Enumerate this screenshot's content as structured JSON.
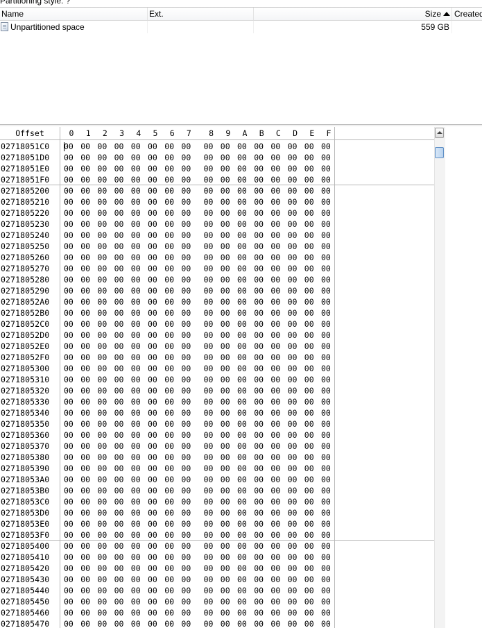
{
  "partitioning_label": "Partitioning style: ?",
  "list": {
    "columns": {
      "name": "Name",
      "ext": "Ext.",
      "size": "Size",
      "created": "Created"
    },
    "rows": [
      {
        "name": "Unpartitioned space",
        "ext": "",
        "size": "559 GB",
        "icon": "file-icon"
      }
    ]
  },
  "hex": {
    "offset_title": "Offset",
    "columns": [
      "0",
      "1",
      "2",
      "3",
      "4",
      "5",
      "6",
      "7",
      "8",
      "9",
      "A",
      "B",
      "C",
      "D",
      "E",
      "F"
    ],
    "cursor_at": "first byte of first row",
    "rows": [
      {
        "offset": "02718051C0",
        "bytes": [
          "00",
          "00",
          "00",
          "00",
          "00",
          "00",
          "00",
          "00",
          "00",
          "00",
          "00",
          "00",
          "00",
          "00",
          "00",
          "00"
        ]
      },
      {
        "offset": "02718051D0",
        "bytes": [
          "00",
          "00",
          "00",
          "00",
          "00",
          "00",
          "00",
          "00",
          "00",
          "00",
          "00",
          "00",
          "00",
          "00",
          "00",
          "00"
        ]
      },
      {
        "offset": "02718051E0",
        "bytes": [
          "00",
          "00",
          "00",
          "00",
          "00",
          "00",
          "00",
          "00",
          "00",
          "00",
          "00",
          "00",
          "00",
          "00",
          "00",
          "00"
        ]
      },
      {
        "offset": "02718051F0",
        "bytes": [
          "00",
          "00",
          "00",
          "00",
          "00",
          "00",
          "00",
          "00",
          "00",
          "00",
          "00",
          "00",
          "00",
          "00",
          "00",
          "00"
        ]
      },
      {
        "offset": "0271805200",
        "bytes": [
          "00",
          "00",
          "00",
          "00",
          "00",
          "00",
          "00",
          "00",
          "00",
          "00",
          "00",
          "00",
          "00",
          "00",
          "00",
          "00"
        ]
      },
      {
        "offset": "0271805210",
        "bytes": [
          "00",
          "00",
          "00",
          "00",
          "00",
          "00",
          "00",
          "00",
          "00",
          "00",
          "00",
          "00",
          "00",
          "00",
          "00",
          "00"
        ]
      },
      {
        "offset": "0271805220",
        "bytes": [
          "00",
          "00",
          "00",
          "00",
          "00",
          "00",
          "00",
          "00",
          "00",
          "00",
          "00",
          "00",
          "00",
          "00",
          "00",
          "00"
        ]
      },
      {
        "offset": "0271805230",
        "bytes": [
          "00",
          "00",
          "00",
          "00",
          "00",
          "00",
          "00",
          "00",
          "00",
          "00",
          "00",
          "00",
          "00",
          "00",
          "00",
          "00"
        ]
      },
      {
        "offset": "0271805240",
        "bytes": [
          "00",
          "00",
          "00",
          "00",
          "00",
          "00",
          "00",
          "00",
          "00",
          "00",
          "00",
          "00",
          "00",
          "00",
          "00",
          "00"
        ]
      },
      {
        "offset": "0271805250",
        "bytes": [
          "00",
          "00",
          "00",
          "00",
          "00",
          "00",
          "00",
          "00",
          "00",
          "00",
          "00",
          "00",
          "00",
          "00",
          "00",
          "00"
        ]
      },
      {
        "offset": "0271805260",
        "bytes": [
          "00",
          "00",
          "00",
          "00",
          "00",
          "00",
          "00",
          "00",
          "00",
          "00",
          "00",
          "00",
          "00",
          "00",
          "00",
          "00"
        ]
      },
      {
        "offset": "0271805270",
        "bytes": [
          "00",
          "00",
          "00",
          "00",
          "00",
          "00",
          "00",
          "00",
          "00",
          "00",
          "00",
          "00",
          "00",
          "00",
          "00",
          "00"
        ]
      },
      {
        "offset": "0271805280",
        "bytes": [
          "00",
          "00",
          "00",
          "00",
          "00",
          "00",
          "00",
          "00",
          "00",
          "00",
          "00",
          "00",
          "00",
          "00",
          "00",
          "00"
        ]
      },
      {
        "offset": "0271805290",
        "bytes": [
          "00",
          "00",
          "00",
          "00",
          "00",
          "00",
          "00",
          "00",
          "00",
          "00",
          "00",
          "00",
          "00",
          "00",
          "00",
          "00"
        ]
      },
      {
        "offset": "02718052A0",
        "bytes": [
          "00",
          "00",
          "00",
          "00",
          "00",
          "00",
          "00",
          "00",
          "00",
          "00",
          "00",
          "00",
          "00",
          "00",
          "00",
          "00"
        ]
      },
      {
        "offset": "02718052B0",
        "bytes": [
          "00",
          "00",
          "00",
          "00",
          "00",
          "00",
          "00",
          "00",
          "00",
          "00",
          "00",
          "00",
          "00",
          "00",
          "00",
          "00"
        ]
      },
      {
        "offset": "02718052C0",
        "bytes": [
          "00",
          "00",
          "00",
          "00",
          "00",
          "00",
          "00",
          "00",
          "00",
          "00",
          "00",
          "00",
          "00",
          "00",
          "00",
          "00"
        ]
      },
      {
        "offset": "02718052D0",
        "bytes": [
          "00",
          "00",
          "00",
          "00",
          "00",
          "00",
          "00",
          "00",
          "00",
          "00",
          "00",
          "00",
          "00",
          "00",
          "00",
          "00"
        ]
      },
      {
        "offset": "02718052E0",
        "bytes": [
          "00",
          "00",
          "00",
          "00",
          "00",
          "00",
          "00",
          "00",
          "00",
          "00",
          "00",
          "00",
          "00",
          "00",
          "00",
          "00"
        ]
      },
      {
        "offset": "02718052F0",
        "bytes": [
          "00",
          "00",
          "00",
          "00",
          "00",
          "00",
          "00",
          "00",
          "00",
          "00",
          "00",
          "00",
          "00",
          "00",
          "00",
          "00"
        ]
      },
      {
        "offset": "0271805300",
        "bytes": [
          "00",
          "00",
          "00",
          "00",
          "00",
          "00",
          "00",
          "00",
          "00",
          "00",
          "00",
          "00",
          "00",
          "00",
          "00",
          "00"
        ]
      },
      {
        "offset": "0271805310",
        "bytes": [
          "00",
          "00",
          "00",
          "00",
          "00",
          "00",
          "00",
          "00",
          "00",
          "00",
          "00",
          "00",
          "00",
          "00",
          "00",
          "00"
        ]
      },
      {
        "offset": "0271805320",
        "bytes": [
          "00",
          "00",
          "00",
          "00",
          "00",
          "00",
          "00",
          "00",
          "00",
          "00",
          "00",
          "00",
          "00",
          "00",
          "00",
          "00"
        ]
      },
      {
        "offset": "0271805330",
        "bytes": [
          "00",
          "00",
          "00",
          "00",
          "00",
          "00",
          "00",
          "00",
          "00",
          "00",
          "00",
          "00",
          "00",
          "00",
          "00",
          "00"
        ]
      },
      {
        "offset": "0271805340",
        "bytes": [
          "00",
          "00",
          "00",
          "00",
          "00",
          "00",
          "00",
          "00",
          "00",
          "00",
          "00",
          "00",
          "00",
          "00",
          "00",
          "00"
        ]
      },
      {
        "offset": "0271805350",
        "bytes": [
          "00",
          "00",
          "00",
          "00",
          "00",
          "00",
          "00",
          "00",
          "00",
          "00",
          "00",
          "00",
          "00",
          "00",
          "00",
          "00"
        ]
      },
      {
        "offset": "0271805360",
        "bytes": [
          "00",
          "00",
          "00",
          "00",
          "00",
          "00",
          "00",
          "00",
          "00",
          "00",
          "00",
          "00",
          "00",
          "00",
          "00",
          "00"
        ]
      },
      {
        "offset": "0271805370",
        "bytes": [
          "00",
          "00",
          "00",
          "00",
          "00",
          "00",
          "00",
          "00",
          "00",
          "00",
          "00",
          "00",
          "00",
          "00",
          "00",
          "00"
        ]
      },
      {
        "offset": "0271805380",
        "bytes": [
          "00",
          "00",
          "00",
          "00",
          "00",
          "00",
          "00",
          "00",
          "00",
          "00",
          "00",
          "00",
          "00",
          "00",
          "00",
          "00"
        ]
      },
      {
        "offset": "0271805390",
        "bytes": [
          "00",
          "00",
          "00",
          "00",
          "00",
          "00",
          "00",
          "00",
          "00",
          "00",
          "00",
          "00",
          "00",
          "00",
          "00",
          "00"
        ]
      },
      {
        "offset": "02718053A0",
        "bytes": [
          "00",
          "00",
          "00",
          "00",
          "00",
          "00",
          "00",
          "00",
          "00",
          "00",
          "00",
          "00",
          "00",
          "00",
          "00",
          "00"
        ]
      },
      {
        "offset": "02718053B0",
        "bytes": [
          "00",
          "00",
          "00",
          "00",
          "00",
          "00",
          "00",
          "00",
          "00",
          "00",
          "00",
          "00",
          "00",
          "00",
          "00",
          "00"
        ]
      },
      {
        "offset": "02718053C0",
        "bytes": [
          "00",
          "00",
          "00",
          "00",
          "00",
          "00",
          "00",
          "00",
          "00",
          "00",
          "00",
          "00",
          "00",
          "00",
          "00",
          "00"
        ]
      },
      {
        "offset": "02718053D0",
        "bytes": [
          "00",
          "00",
          "00",
          "00",
          "00",
          "00",
          "00",
          "00",
          "00",
          "00",
          "00",
          "00",
          "00",
          "00",
          "00",
          "00"
        ]
      },
      {
        "offset": "02718053E0",
        "bytes": [
          "00",
          "00",
          "00",
          "00",
          "00",
          "00",
          "00",
          "00",
          "00",
          "00",
          "00",
          "00",
          "00",
          "00",
          "00",
          "00"
        ]
      },
      {
        "offset": "02718053F0",
        "bytes": [
          "00",
          "00",
          "00",
          "00",
          "00",
          "00",
          "00",
          "00",
          "00",
          "00",
          "00",
          "00",
          "00",
          "00",
          "00",
          "00"
        ]
      },
      {
        "offset": "0271805400",
        "bytes": [
          "00",
          "00",
          "00",
          "00",
          "00",
          "00",
          "00",
          "00",
          "00",
          "00",
          "00",
          "00",
          "00",
          "00",
          "00",
          "00"
        ]
      },
      {
        "offset": "0271805410",
        "bytes": [
          "00",
          "00",
          "00",
          "00",
          "00",
          "00",
          "00",
          "00",
          "00",
          "00",
          "00",
          "00",
          "00",
          "00",
          "00",
          "00"
        ]
      },
      {
        "offset": "0271805420",
        "bytes": [
          "00",
          "00",
          "00",
          "00",
          "00",
          "00",
          "00",
          "00",
          "00",
          "00",
          "00",
          "00",
          "00",
          "00",
          "00",
          "00"
        ]
      },
      {
        "offset": "0271805430",
        "bytes": [
          "00",
          "00",
          "00",
          "00",
          "00",
          "00",
          "00",
          "00",
          "00",
          "00",
          "00",
          "00",
          "00",
          "00",
          "00",
          "00"
        ]
      },
      {
        "offset": "0271805440",
        "bytes": [
          "00",
          "00",
          "00",
          "00",
          "00",
          "00",
          "00",
          "00",
          "00",
          "00",
          "00",
          "00",
          "00",
          "00",
          "00",
          "00"
        ]
      },
      {
        "offset": "0271805450",
        "bytes": [
          "00",
          "00",
          "00",
          "00",
          "00",
          "00",
          "00",
          "00",
          "00",
          "00",
          "00",
          "00",
          "00",
          "00",
          "00",
          "00"
        ]
      },
      {
        "offset": "0271805460",
        "bytes": [
          "00",
          "00",
          "00",
          "00",
          "00",
          "00",
          "00",
          "00",
          "00",
          "00",
          "00",
          "00",
          "00",
          "00",
          "00",
          "00"
        ]
      },
      {
        "offset": "0271805470",
        "bytes": [
          "00",
          "00",
          "00",
          "00",
          "00",
          "00",
          "00",
          "00",
          "00",
          "00",
          "00",
          "00",
          "00",
          "00",
          "00",
          "00"
        ]
      }
    ]
  },
  "scrollbar": {
    "up_icon": "scroll-up-arrow-icon",
    "thumb": "scroll-thumb"
  }
}
